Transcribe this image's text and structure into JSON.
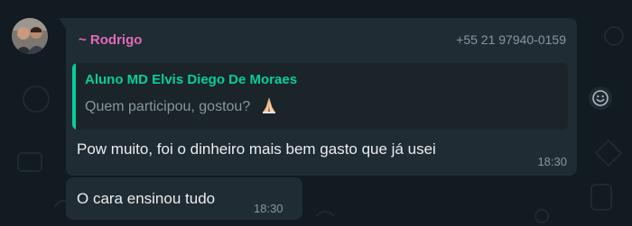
{
  "group_message": {
    "sender_name": "~ Rodrigo",
    "sender_phone": "+55 21 97940-0159",
    "quoted": {
      "author": "Aluno MD Elvis Diego De Moraes",
      "text": "Quem participou, gostou?",
      "emoji_icon": "folded-hands-icon"
    },
    "text": "Pow muito, foi o dinheiro mais bem gasto que já usei",
    "time": "18:30"
  },
  "followup_message": {
    "text": "O cara ensinou tudo",
    "time": "18:30"
  },
  "reaction_button": {
    "icon": "smiley-icon"
  },
  "colors": {
    "background": "#111b21",
    "bubble": "#202c33",
    "sender": "#e26ab6",
    "quote_accent": "#06cf9c",
    "meta_text": "#8696a0"
  }
}
